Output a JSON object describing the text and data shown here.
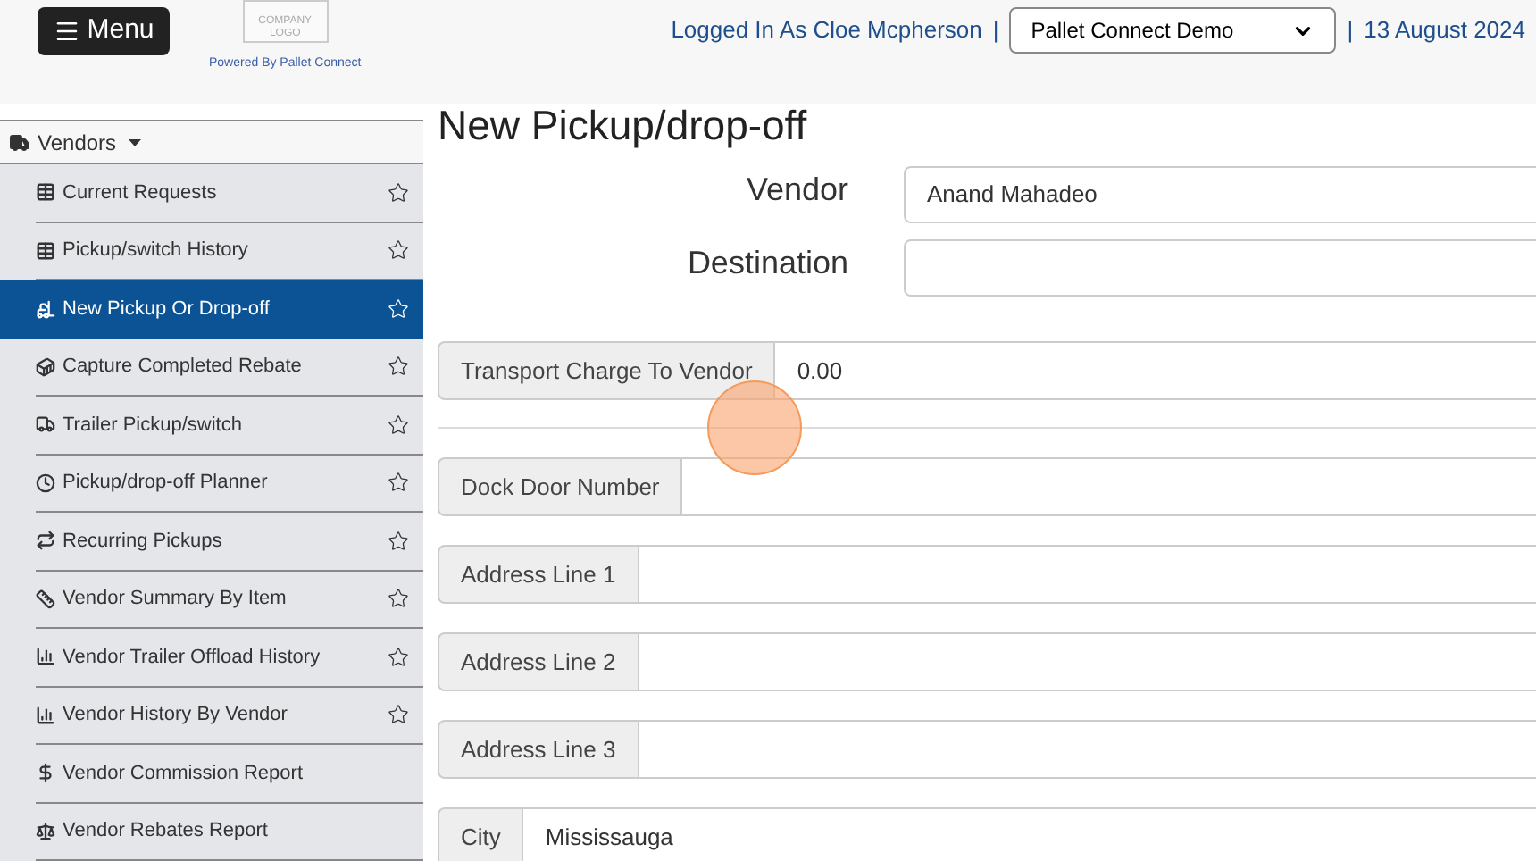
{
  "header": {
    "menu_button": "Menu",
    "logo_lines": [
      "COMPANY",
      "LOGO"
    ],
    "powered_by": "Powered By Pallet Connect",
    "logged_in": "Logged In As Cloe Mcpherson",
    "separator_1": "|",
    "company_select": "Pallet Connect Demo",
    "separator_2": "|",
    "date": "13 August 2024"
  },
  "sidebar": {
    "section": "Vendors",
    "items": [
      {
        "label": "Current Requests",
        "selected": false,
        "star": true
      },
      {
        "label": "Pickup/switch History",
        "selected": false,
        "star": true
      },
      {
        "label": "New Pickup Or Drop-off",
        "selected": true,
        "star": true
      },
      {
        "label": "Capture Completed Rebate",
        "selected": false,
        "star": true
      },
      {
        "label": "Trailer Pickup/switch",
        "selected": false,
        "star": true
      },
      {
        "label": "Pickup/drop-off Planner",
        "selected": false,
        "star": true
      },
      {
        "label": "Recurring Pickups",
        "selected": false,
        "star": true
      },
      {
        "label": "Vendor Summary By Item",
        "selected": false,
        "star": true
      },
      {
        "label": "Vendor Trailer Offload History",
        "selected": false,
        "star": true
      },
      {
        "label": "Vendor History By Vendor",
        "selected": false,
        "star": true
      },
      {
        "label": "Vendor Commission Report",
        "selected": false,
        "star": false
      },
      {
        "label": "Vendor Rebates Report",
        "selected": false,
        "star": false
      }
    ]
  },
  "page_title": "New Pickup/drop-off",
  "top_fields": [
    {
      "label": "Vendor",
      "value": "Anand Mahadeo"
    },
    {
      "label": "Destination"
    }
  ],
  "group_fields": [
    {
      "label": "Transport Charge To Vendor",
      "value": "0.00",
      "divider_after": true
    },
    {
      "label": "Dock Door Number"
    },
    {
      "label": "Address Line 1"
    },
    {
      "label": "Address Line 2"
    },
    {
      "label": "Address Line 3"
    },
    {
      "label": "City",
      "value": "Mississauga"
    }
  ]
}
